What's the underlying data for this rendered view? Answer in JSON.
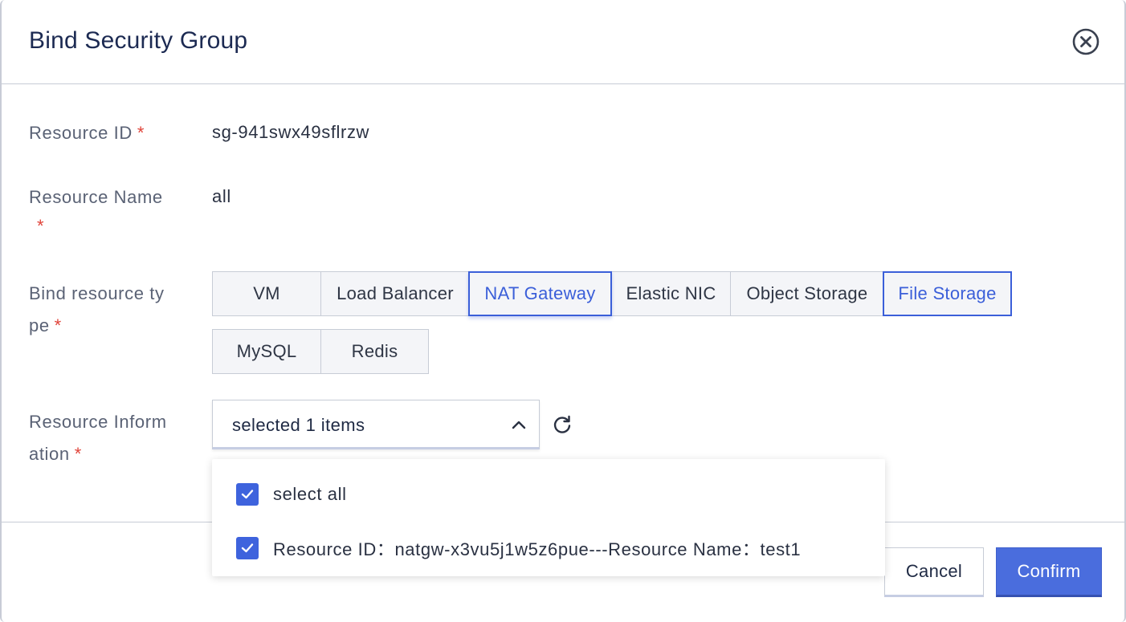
{
  "dialog": {
    "title": "Bind Security Group"
  },
  "form": {
    "resource_id_label": "Resource ID",
    "resource_id_value": "sg-941swx49sflrzw",
    "resource_name_label": "Resource Name",
    "resource_name_value": "all",
    "bind_type_label_line1": "Bind resource ty",
    "bind_type_label_line2": "pe",
    "resource_info_label_line1": "Resource Inform",
    "resource_info_label_line2": "ation",
    "required_mark": "*"
  },
  "resource_types": [
    {
      "label": "VM",
      "active": false
    },
    {
      "label": "Load Balancer",
      "active": false
    },
    {
      "label": "NAT Gateway",
      "active": true
    },
    {
      "label": "Elastic NIC",
      "active": false
    },
    {
      "label": "Object Storage",
      "active": false
    },
    {
      "label": "File Storage",
      "active": true
    },
    {
      "label": "MySQL",
      "active": false
    },
    {
      "label": "Redis",
      "active": false
    }
  ],
  "select": {
    "display_text": "selected 1 items",
    "options": [
      {
        "label": "select all",
        "checked": true
      },
      {
        "label": "Resource ID：natgw-x3vu5j1w5z6pue---Resource Name：test1",
        "checked": true
      }
    ]
  },
  "footer": {
    "cancel_label": "Cancel",
    "confirm_label": "Confirm"
  },
  "colors": {
    "accent": "#3b5fd9",
    "required": "#e0443a",
    "confirm_bg": "#4a6ddd"
  }
}
